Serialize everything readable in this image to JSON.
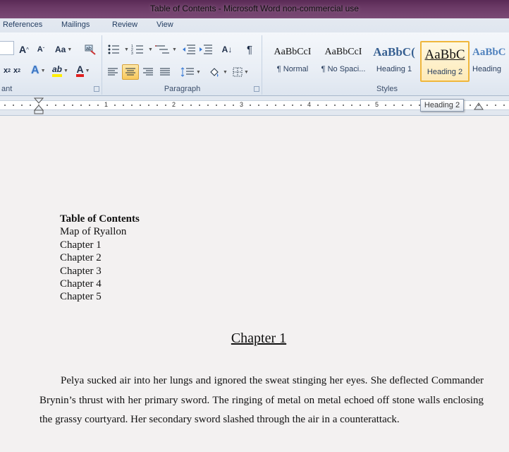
{
  "window": {
    "title": "Table of Contents  -  Microsoft Word non-commercial use"
  },
  "tabs": [
    "References",
    "Mailings",
    "Review",
    "View"
  ],
  "ribbon": {
    "font_group_label": "ant",
    "paragraph_group_label": "Paragraph",
    "styles_group_label": "Styles",
    "grow_font": "A",
    "shrink_font": "A",
    "change_case": "Aa",
    "subscript": "x",
    "superscript": "x",
    "font_color": "A",
    "highlight": "ab",
    "text_effect": "A",
    "pilcrow": "¶",
    "sort": "A↓"
  },
  "styles": [
    {
      "preview": "AaBbCcI",
      "name": "¶ Normal"
    },
    {
      "preview": "AaBbCcI",
      "name": "¶ No Spaci..."
    },
    {
      "preview": "AaBbC(",
      "name": "Heading 1"
    },
    {
      "preview": "AaBbC",
      "name": "Heading 2"
    },
    {
      "preview": "AaBbC",
      "name": "Heading"
    }
  ],
  "ruler": {
    "numbers": [
      "1",
      "2",
      "3",
      "4",
      "5"
    ]
  },
  "tooltip": "Heading 2",
  "document": {
    "toc_title": "Table of Contents",
    "toc_items": [
      "Map of Ryallon",
      "Chapter 1",
      "Chapter 2",
      "Chapter 3",
      "Chapter 4",
      "Chapter 5"
    ],
    "chapter_heading": "Chapter 1",
    "paragraph": "Pelya sucked air into her lungs and ignored the sweat stinging her eyes.  She deflected Commander Brynin’s thrust with her primary sword.  The ringing of metal on metal echoed off stone walls enclosing the grassy courtyard.  Her secondary sword slashed through the air in a counterattack."
  },
  "colors": {
    "title_bar": "#6b3a66",
    "ribbon": "#e9eef5",
    "selected": "#f8c85a"
  }
}
